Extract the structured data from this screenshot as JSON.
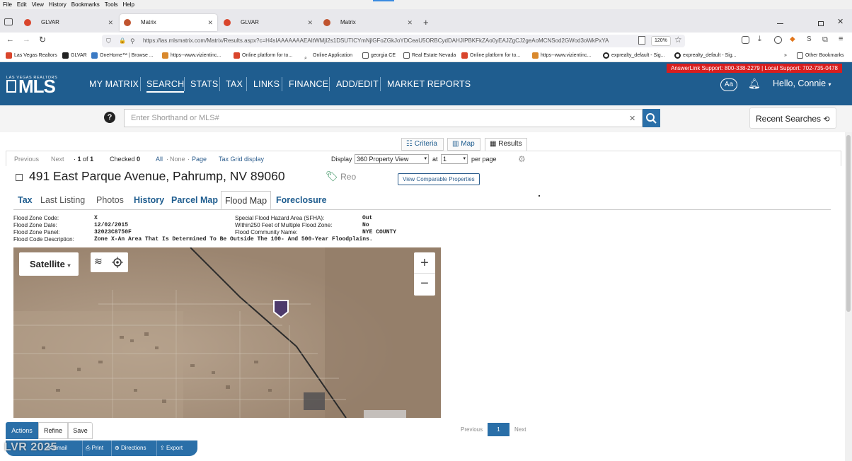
{
  "menu": [
    "File",
    "Edit",
    "View",
    "History",
    "Bookmarks",
    "Tools",
    "Help"
  ],
  "tabs": [
    {
      "label": "GLVAR",
      "active": false
    },
    {
      "label": "Matrix",
      "active": true
    },
    {
      "label": "GLVAR",
      "active": false
    },
    {
      "label": "Matrix",
      "active": false
    }
  ],
  "url": "https://las.mlsmatrix.com/Matrix/Results.aspx?c=H4sIAAAAAAAEAItWMjI2s1DSUTICYmNjlGFoZGkJoYDCeaU5ORBCydDAHJIPBKFkZAo0yEAJZgCJ2geAoMCNSod2GWod3oWkPxYA",
  "zoom": "120%",
  "bookmarks": [
    "Las Vegas Realtors",
    "GLVAR",
    "OneHome™ | Browse ...",
    "https--www.vizientinc...",
    "Online platform for to...",
    "Online Application",
    "georgia CE",
    "Real Estate Nevada",
    "Online platform for to...",
    "https--www.vizientinc...",
    "exprealty_default - Sig...",
    "exprealty_default - Sig...",
    "Other Bookmarks"
  ],
  "header": {
    "logo_top": "LAS VEGAS REALTORS",
    "logo_main": "MLS",
    "support": "AnswerLink Support: 800-338-2279 | Local Support: 702-735-0478",
    "nav": [
      "MY MATRIX",
      "SEARCH",
      "STATS",
      "TAX",
      "LINKS",
      "FINANCE",
      "ADD/EDIT",
      "MARKET REPORTS"
    ],
    "aa": "Aa",
    "greeting": "Hello, Connie"
  },
  "search": {
    "placeholder": "Enter Shorthand or MLS#",
    "recent": "Recent Searches"
  },
  "views": {
    "criteria": "Criteria",
    "map": "Map",
    "results": "Results"
  },
  "pager": {
    "previous": "Previous",
    "next": "Next",
    "position": "1",
    "of": "of",
    "total": "1",
    "checked_label": "Checked",
    "checked_count": "0",
    "all": "All",
    "none": "None",
    "page": "Page",
    "tax_grid": "Tax Grid display",
    "display": "Display",
    "display_value": "360 Property View",
    "at": "at",
    "per_page_value": "1",
    "per_page": "per page"
  },
  "listing": {
    "address": "491 East Parque Avenue, Pahrump, NV 89060",
    "status": "Reo",
    "comparable": "View Comparable Properties"
  },
  "detail_tabs": [
    {
      "label": "Tax",
      "active": false
    },
    {
      "label": "Last Listing",
      "active": false
    },
    {
      "label": "Photos",
      "active": false
    },
    {
      "label": "History",
      "active": false
    },
    {
      "label": "Parcel Map",
      "active": false
    },
    {
      "label": "Flood Map",
      "active": true
    },
    {
      "label": "Foreclosure",
      "active": false
    }
  ],
  "flood": {
    "left": [
      {
        "label": "Flood Zone Code:",
        "value": "X"
      },
      {
        "label": "Flood Zone Date:",
        "value": "12/02/2015"
      },
      {
        "label": "Flood Zone Panel:",
        "value": "32023C8750F"
      },
      {
        "label": "Flood Code Description:",
        "value": "Zone X-An Area That Is Determined To Be Outside The 100- And 500-Year Floodplains."
      }
    ],
    "right": [
      {
        "label": "Special Flood Hazard Area (SFHA):",
        "value": "Out"
      },
      {
        "label": "Within250 Feet of Multiple Flood Zone:",
        "value": "No"
      },
      {
        "label": "Flood Community Name:",
        "value": "NYE COUNTY"
      }
    ]
  },
  "map": {
    "type": "Satellite",
    "zoom_in": "+",
    "zoom_out": "−"
  },
  "bottom_pager": {
    "previous": "Previous",
    "page": "1",
    "next": "Next"
  },
  "actions": {
    "tabs": [
      "Actions",
      "Refine",
      "Save"
    ],
    "buttons": [
      "Email",
      "Print",
      "Directions",
      "Export"
    ]
  },
  "watermark": "LVR 2025",
  "colors": {
    "brand": "#1f5d8f",
    "support": "#d81e1e",
    "status": "#2e8b57",
    "link": "#1f5d8f"
  }
}
